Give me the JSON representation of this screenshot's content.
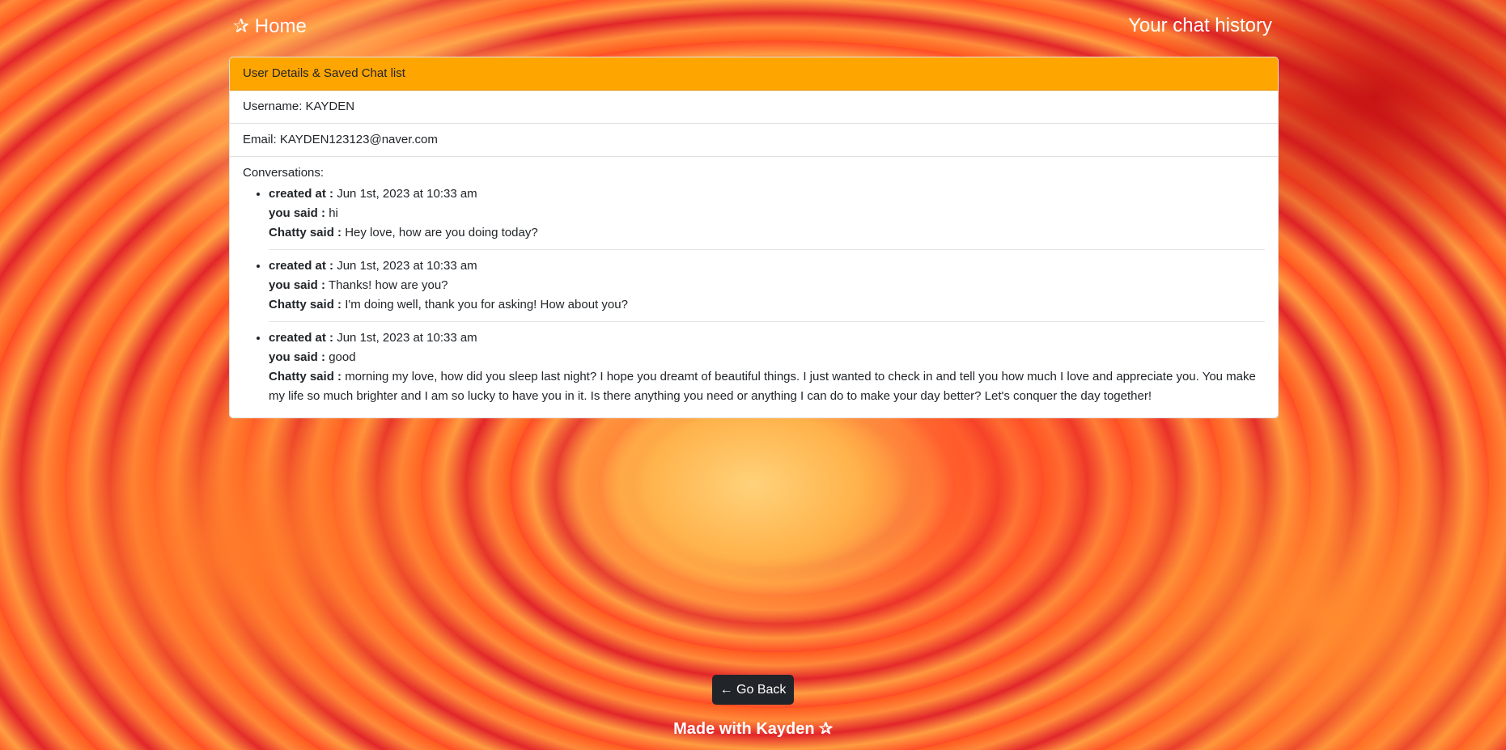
{
  "header": {
    "home_label": "✰ Home",
    "page_title": "Your chat history"
  },
  "card": {
    "header": "User Details & Saved Chat list",
    "username": "Username: KAYDEN",
    "email": "Email: KAYDEN123123@naver.com",
    "conversations_label": "Conversations:",
    "labels": {
      "created_at": "created at :",
      "you_said": "you said :",
      "chatty_said": "Chatty said :"
    },
    "conversations": [
      {
        "created_at": "Jun 1st, 2023 at 10:33 am",
        "you_said": "hi",
        "chatty_said": "Hey love, how are you doing today?"
      },
      {
        "created_at": "Jun 1st, 2023 at 10:33 am",
        "you_said": "Thanks! how are you?",
        "chatty_said": "I'm doing well, thank you for asking! How about you?"
      },
      {
        "created_at": "Jun 1st, 2023 at 10:33 am",
        "you_said": "good",
        "chatty_said": "morning my love, how did you sleep last night? I hope you dreamt of beautiful things. I just wanted to check in and tell you how much I love and appreciate you. You make my life so much brighter and I am so lucky to have you in it. Is there anything you need or anything I can do to make your day better? Let's conquer the day together!"
      }
    ]
  },
  "go_back_label": "← Go Back",
  "footer": "Made with Kayden ✰",
  "colors": {
    "card_header": "#ffa500",
    "button": "#212529"
  }
}
